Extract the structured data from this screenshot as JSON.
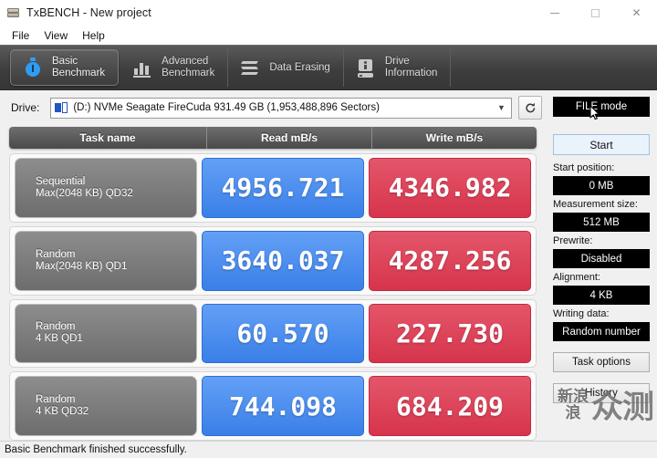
{
  "window": {
    "title": "TxBENCH - New project",
    "icon": "drive-stack-icon",
    "minimize": "minimize-icon",
    "maximize": "maximize-icon",
    "close": "close-icon"
  },
  "menu": {
    "items": [
      {
        "label": "File"
      },
      {
        "label": "View"
      },
      {
        "label": "Help"
      }
    ]
  },
  "tabs": [
    {
      "label": "Basic\nBenchmark",
      "icon": "stopwatch-icon",
      "active": true
    },
    {
      "label": "Advanced\nBenchmark",
      "icon": "bar-chart-icon",
      "active": false
    },
    {
      "label": "Data Erasing",
      "icon": "erase-zigzag-icon",
      "active": false
    },
    {
      "label": "Drive\nInformation",
      "icon": "drive-info-icon",
      "active": false
    }
  ],
  "drive": {
    "label": "Drive:",
    "selected": "(D:) NVMe Seagate FireCuda  931.49 GB (1,953,488,896 Sectors)",
    "dropdown_arrow": "chevron-down-icon",
    "refresh_icon": "refresh-icon"
  },
  "table": {
    "headers": {
      "task": "Task name",
      "read": "Read mB/s",
      "write": "Write mB/s"
    },
    "rows": [
      {
        "task_line1": "Sequential",
        "task_line2": "Max(2048 KB) QD32",
        "read": "4956.721",
        "write": "4346.982"
      },
      {
        "task_line1": "Random",
        "task_line2": "Max(2048 KB) QD1",
        "read": "3640.037",
        "write": "4287.256"
      },
      {
        "task_line1": "Random",
        "task_line2": "4 KB QD1",
        "read": "60.570",
        "write": "227.730"
      },
      {
        "task_line1": "Random",
        "task_line2": "4 KB QD32",
        "read": "744.098",
        "write": "684.209"
      }
    ]
  },
  "sidebar": {
    "file_mode": "FILE mode",
    "start": "Start",
    "start_position_label": "Start position:",
    "start_position_value": "0 MB",
    "measurement_size_label": "Measurement size:",
    "measurement_size_value": "512 MB",
    "prewrite_label": "Prewrite:",
    "prewrite_value": "Disabled",
    "alignment_label": "Alignment:",
    "alignment_value": "4 KB",
    "writing_data_label": "Writing data:",
    "writing_data_value": "Random number",
    "task_options": "Task options",
    "history": "History"
  },
  "watermark": {
    "line1": "新浪",
    "line2": "众测"
  },
  "status": {
    "message": "Basic Benchmark finished successfully."
  },
  "colors": {
    "read_blue": "#3a7fe8",
    "write_red": "#d6344c",
    "tab_bar": "#4a4a4a",
    "accent_icon": "#2e9df4"
  }
}
